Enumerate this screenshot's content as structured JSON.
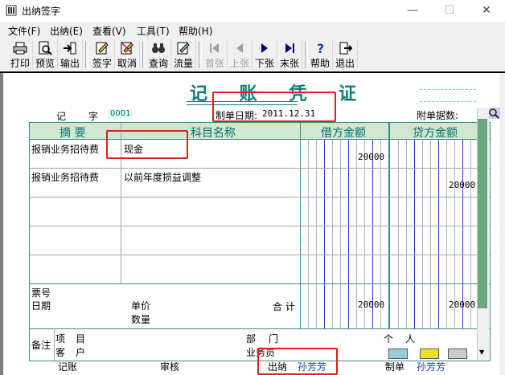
{
  "window": {
    "title": "出纳签字",
    "minimize": "—",
    "maximize": "☐",
    "close": "✕"
  },
  "menu": [
    "文件(F)",
    "出纳(E)",
    "查看(V)",
    "工具(T)",
    "帮助(H)"
  ],
  "toolbar": [
    {
      "label": "打印",
      "icon": "printer-icon",
      "enabled": true
    },
    {
      "label": "预览",
      "icon": "preview-icon",
      "enabled": true
    },
    {
      "label": "输出",
      "icon": "export-icon",
      "enabled": true
    },
    {
      "label": "签字",
      "icon": "sign-icon",
      "enabled": true
    },
    {
      "label": "取消",
      "icon": "cancel-sign-icon",
      "enabled": true
    },
    {
      "label": "查询",
      "icon": "binoculars-icon",
      "enabled": true
    },
    {
      "label": "流量",
      "icon": "flow-icon",
      "enabled": true
    },
    {
      "label": "首张",
      "icon": "first-icon",
      "enabled": false
    },
    {
      "label": "上张",
      "icon": "prev-icon",
      "enabled": false
    },
    {
      "label": "下张",
      "icon": "next-icon",
      "enabled": true
    },
    {
      "label": "末张",
      "icon": "last-icon",
      "enabled": true
    },
    {
      "label": "帮助",
      "icon": "help-icon",
      "enabled": true
    },
    {
      "label": "退出",
      "icon": "exit-icon",
      "enabled": true
    }
  ],
  "voucher": {
    "title": "记 账 凭 证",
    "type_label": "记",
    "no_label": "字",
    "number": "0001",
    "date_label": "制单日期:",
    "date": "2011.12.31",
    "attachments_label": "附单据数:",
    "headers": {
      "summary": "摘 要",
      "account": "科目名称",
      "debit": "借方金额",
      "credit": "贷方金额"
    },
    "rows": [
      {
        "summary": "报销业务招待费",
        "account": "现金",
        "debit": "20000",
        "credit": ""
      },
      {
        "summary": "报销业务招待费",
        "account": "以前年度损益调整",
        "debit": "",
        "credit": "20000"
      }
    ],
    "bottom": {
      "ticket_no": "票号",
      "date": "日期",
      "unit_price": "单价",
      "quantity": "数量",
      "total_label": "合 计",
      "total_debit": "20000",
      "total_credit": "20000"
    },
    "remarks": {
      "label": "备注",
      "project_a": "项",
      "project_b": "目",
      "customer_a": "客",
      "customer_b": "户",
      "dept_a": "部",
      "dept_b": "门",
      "salesman": "业务员",
      "person_a": "个",
      "person_b": "人"
    },
    "footer": {
      "bookkeeper": "记账",
      "reviewer": "审核",
      "cashier_label": "出纳",
      "cashier": "孙芳芳",
      "maker_label": "制单",
      "maker": "孙芳芳"
    }
  }
}
